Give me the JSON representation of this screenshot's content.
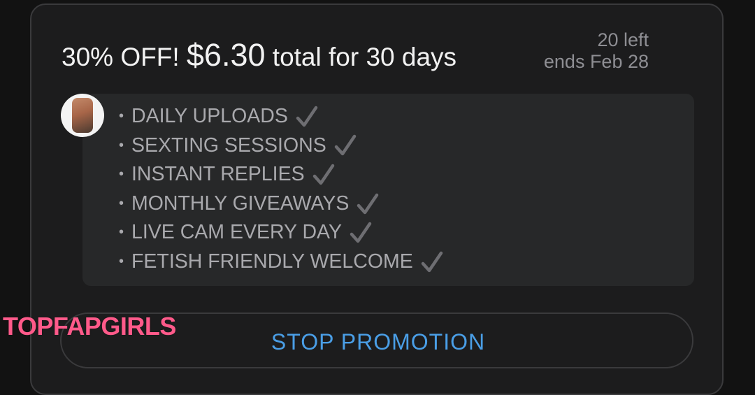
{
  "promo": {
    "discount": "30% OFF!",
    "price": "$6.30",
    "duration_text": "total for 30 days",
    "remaining": "20 left",
    "ends": "ends Feb 28"
  },
  "features": [
    "DAILY UPLOADS",
    "SEXTING SESSIONS",
    "INSTANT REPLIES",
    "MONTHLY GIVEAWAYS",
    "LIVE CAM EVERY DAY",
    "FETISH FRIENDLY WELCOME"
  ],
  "bullet_char": "•",
  "check_icon": "checkmark-icon",
  "actions": {
    "stop_label": "STOP PROMOTION"
  },
  "watermark": "TOPFAPGIRLS",
  "colors": {
    "background": "#121212",
    "card": "#1c1c1d",
    "message_box": "#272829",
    "accent_blue": "#4a9ee6",
    "watermark_pink": "#ff5a8a"
  }
}
